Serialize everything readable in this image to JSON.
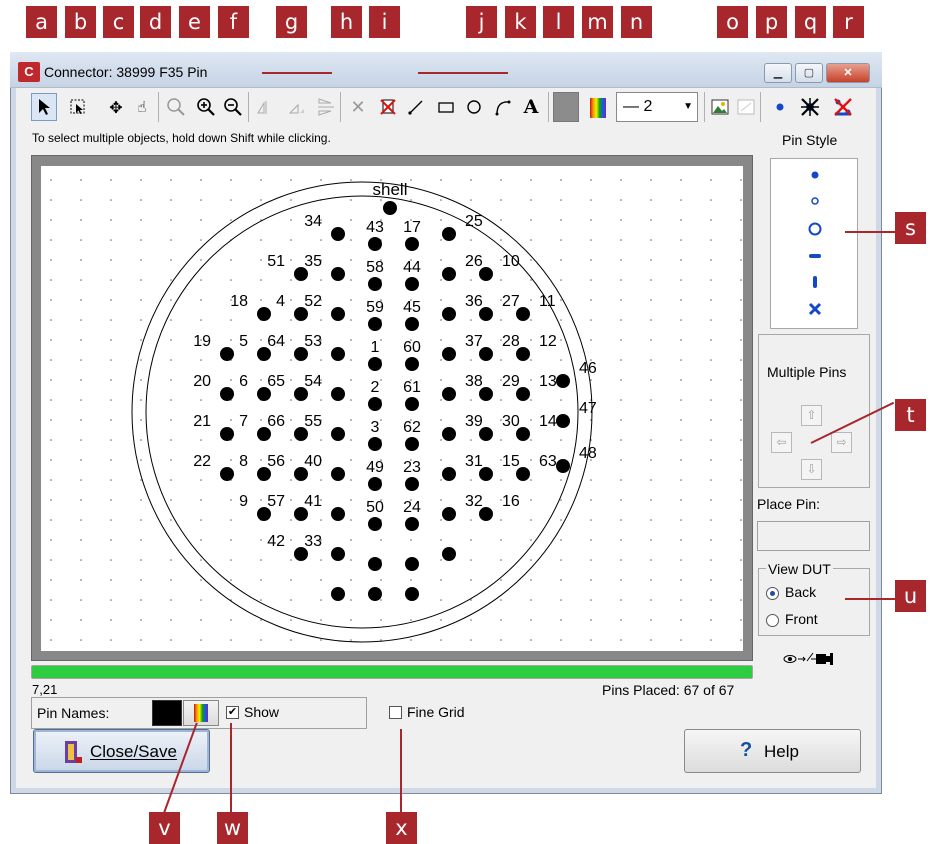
{
  "window": {
    "title": "Connector: 38999 F35 Pin"
  },
  "toolbar": {
    "line_width_value": "— 2",
    "icons": [
      "pointer-icon",
      "box-select-icon",
      "move-icon",
      "hand-icon",
      "zoom-icon",
      "zoom-in-icon",
      "zoom-out-icon",
      "mirror-h-icon",
      "mirror-v-icon",
      "flip-icon",
      "delete-icon",
      "delete-all-icon",
      "line-icon",
      "rectangle-icon",
      "circle-icon",
      "arc-icon",
      "text-icon",
      "gray-fill-icon",
      "color-palette-icon",
      "line-width-select",
      "image-icon",
      "image-disabled-icon",
      "pin-dot-icon",
      "delete-pin-icon",
      "delete-pins-icon"
    ]
  },
  "hint": "To select multiple objects, hold down Shift while clicking.",
  "pin_style": {
    "label": "Pin Style"
  },
  "multiple_pins": {
    "label": "Multiple Pins"
  },
  "place_pin": {
    "label": "Place Pin:",
    "value": ""
  },
  "view_dut": {
    "label": "View DUT",
    "options": [
      "Back",
      "Front"
    ],
    "selected": "Back"
  },
  "status": {
    "coords": "7,21",
    "pins_placed": "Pins Placed: 67 of 67",
    "progress": 1.0
  },
  "pin_names": {
    "label": "Pin Names:",
    "show_label": "Show",
    "show_checked": true
  },
  "fine_grid": {
    "label": "Fine Grid",
    "checked": false
  },
  "buttons": {
    "close_save": "Close/Save",
    "help": "Help"
  },
  "connector": {
    "shell_label": "shell",
    "pins": [
      "34",
      "25",
      "43",
      "17",
      "51",
      "35",
      "26",
      "10",
      "58",
      "44",
      "18",
      "4",
      "52",
      "36",
      "27",
      "11",
      "59",
      "45",
      "19",
      "5",
      "64",
      "53",
      "37",
      "28",
      "12",
      "1",
      "60",
      "46",
      "20",
      "6",
      "65",
      "54",
      "38",
      "29",
      "13",
      "2",
      "61",
      "47",
      "21",
      "7",
      "66",
      "55",
      "39",
      "30",
      "14",
      "3",
      "62",
      "48",
      "22",
      "8",
      "56",
      "40",
      "31",
      "15",
      "63",
      "49",
      "23",
      "9",
      "57",
      "41",
      "32",
      "16",
      "50",
      "24",
      "42",
      "33"
    ]
  },
  "callouts": [
    "a",
    "b",
    "c",
    "d",
    "e",
    "f",
    "g",
    "h",
    "i",
    "j",
    "k",
    "l",
    "m",
    "n",
    "o",
    "p",
    "q",
    "r",
    "s",
    "t",
    "u",
    "v",
    "w",
    "x"
  ],
  "colors": {
    "callout": "#a8272d",
    "progress": "#2ecc40",
    "pin_blue": "#1448c8"
  }
}
